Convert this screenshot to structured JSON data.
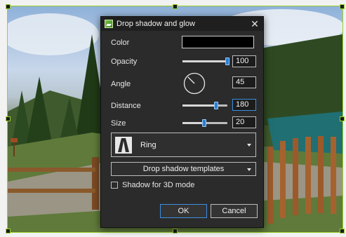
{
  "dialog": {
    "title": "Drop shadow and glow",
    "color_label": "Color",
    "color_value": "#000000",
    "opacity_label": "Opacity",
    "opacity_value": "100",
    "angle_label": "Angle",
    "angle_value": "45",
    "distance_label": "Distance",
    "distance_value": "180",
    "size_label": "Size",
    "size_value": "20",
    "shape_selected": "Ring",
    "templates_label": "Drop shadow templates",
    "shadow3d_label": "Shadow for 3D mode",
    "shadow3d_checked": false,
    "ok_label": "OK",
    "cancel_label": "Cancel"
  },
  "sliders": {
    "opacity_fraction": 1.0,
    "distance_fraction": 0.75,
    "size_fraction": 0.48
  },
  "colors": {
    "accent": "#2b7fd4",
    "selection_frame": "#9bd12b",
    "dialog_bg": "#2b2b2b"
  },
  "icons": {
    "app": "app-logo-icon",
    "close": "close-icon",
    "dropdown": "chevron-down-icon",
    "shape_preview": "ring-shape-icon"
  }
}
